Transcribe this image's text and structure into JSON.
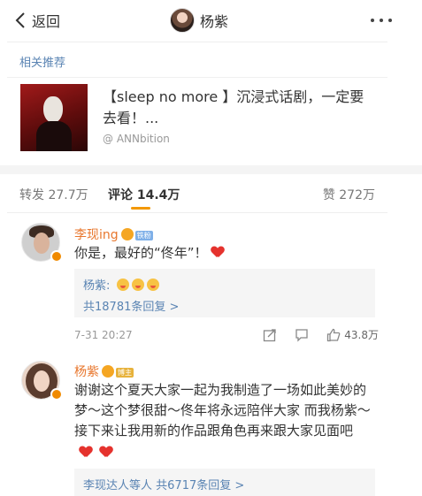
{
  "header": {
    "back_label": "返回",
    "title": "杨紫",
    "more_icon": "more-dots-icon"
  },
  "related": {
    "title": "相关推荐",
    "text": "【sleep no more 】沉浸式话剧，一定要去看！...",
    "source": "@ ANNbition"
  },
  "tabs": {
    "repost": "转发 27.7万",
    "comment": "评论 14.4万",
    "like": "赞 272万"
  },
  "colors": {
    "accent": "#f39800",
    "link": "#5a84b3",
    "username": "#e8772e",
    "heart": "#e5322d"
  },
  "comments": [
    {
      "user": "李现ing",
      "badge": "铁粉",
      "text": "你是，最好的“佟年”！",
      "reply_prefix": "杨紫:",
      "reply_count": "共18781条回复 >",
      "time": "7-31 20:27",
      "likes": "43.8万"
    },
    {
      "user": "杨紫",
      "badge": "博主",
      "text": "谢谢这个夏天大家一起为我制造了一场如此美妙的梦～这个梦很甜～佟年将永远陪伴大家 而我杨紫～接下来让我用新的作品跟角色再来跟大家见面吧",
      "reply_prefix": "李现达人等人",
      "reply_count": "共6717条回复 >"
    }
  ]
}
